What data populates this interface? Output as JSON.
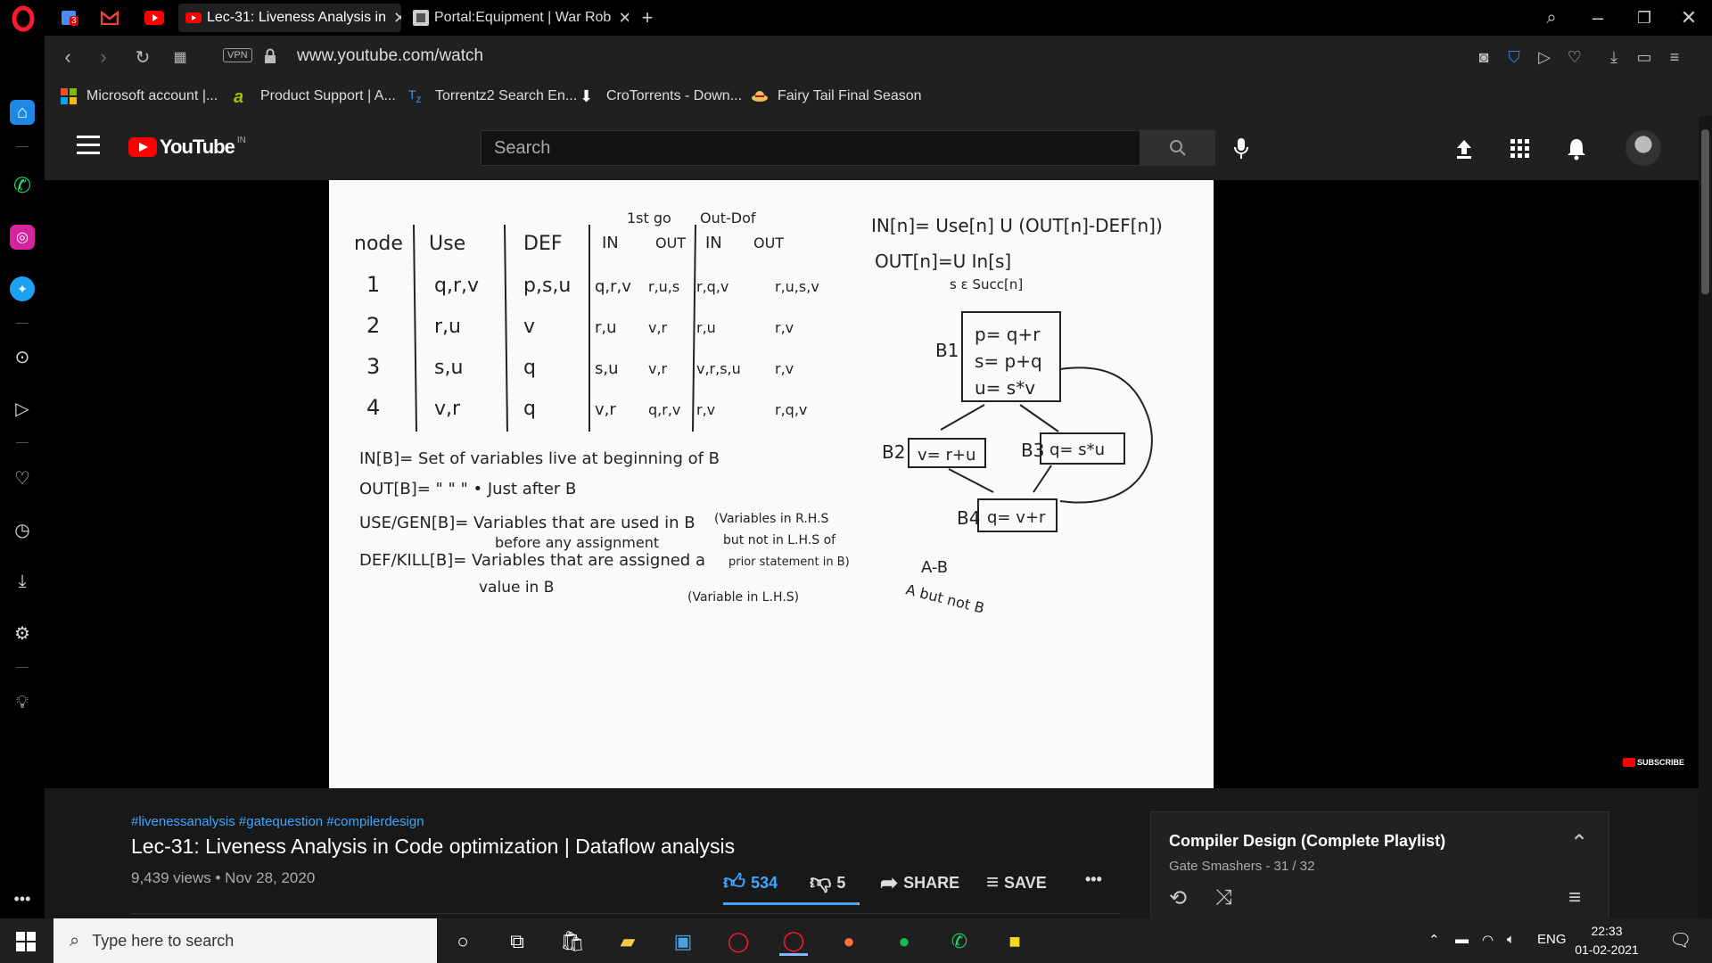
{
  "browser": {
    "tabs": [
      {
        "title": "Lec-31: Liveness Analysis in",
        "favicon": "youtube-icon",
        "active": true
      },
      {
        "title": "Portal:Equipment | War Rob",
        "favicon": "wiki-icon",
        "active": false
      }
    ],
    "pinned_badge": "3",
    "address": {
      "vpn_label": "VPN",
      "url": "www.youtube.com/watch"
    },
    "bookmarks": [
      {
        "label": "Microsoft account |...",
        "icon": "microsoft-icon"
      },
      {
        "label": "Product Support | A...",
        "icon": "product-support-icon"
      },
      {
        "label": "Torrentz2 Search En...",
        "icon": "torrentz-icon"
      },
      {
        "label": "CroTorrents - Down...",
        "icon": "download-arrow-icon"
      },
      {
        "label": "Fairy Tail Final Season",
        "icon": "straw-hat-icon"
      }
    ]
  },
  "youtube": {
    "logo_text": "YouTube",
    "country_code": "IN",
    "search_placeholder": "Search",
    "subscribe_watermark": "SUBSCRIBE",
    "video": {
      "hashtags": "#livenessanalysis #gatequestion #compilerdesign",
      "title": "Lec-31: Liveness Analysis in Code optimization | Dataflow analysis",
      "meta": "9,439 views • Nov 28, 2020",
      "likes": "534",
      "dislikes": "5",
      "share_label": "SHARE",
      "save_label": "SAVE",
      "like_ratio": 0.99
    },
    "playlist": {
      "title": "Compiler Design (Complete Playlist)",
      "subtitle": "Gate Smashers - 31 / 32"
    }
  },
  "whiteboard": {
    "table_headers": [
      "node",
      "Use",
      "DEF",
      "1st go",
      "IN",
      "OUT",
      "Out-Dof",
      "IN",
      "OUT"
    ],
    "rows": [
      {
        "node": "1",
        "use": "q,r,v",
        "def": "p,s,u",
        "in1": "q,r,v",
        "out1": "r,u,s",
        "in2": "r,q,v",
        "out2": "r,u,s,v"
      },
      {
        "node": "2",
        "use": "r,u",
        "def": "v",
        "in1": "r,u",
        "out1": "v,r",
        "in2": "r,u",
        "out2": "r,v"
      },
      {
        "node": "3",
        "use": "s,u",
        "def": "q",
        "in1": "s,u",
        "out1": "v,r",
        "in2": "v,r,s,u",
        "out2": "r,v"
      },
      {
        "node": "4",
        "use": "v,r",
        "def": "q",
        "in1": "v,r",
        "out1": "q,r,v",
        "in2": "r,v",
        "out2": "r,q,v"
      }
    ],
    "equations": [
      "IN[n]= Use[n] U (OUT[n]-DEF[n])",
      "OUT[n]=U In[s]",
      "s ε Succ[n]"
    ],
    "blocks": {
      "b1_label": "B1",
      "b1_lines": [
        "p= q+r",
        "s= p+q",
        "u= s*v"
      ],
      "b2_label": "B2",
      "b2": "v= r+u",
      "b3_label": "B3",
      "b3": "q= s*u",
      "b4_label": "B4",
      "b4": "q= v+r"
    },
    "notes": [
      "IN[B]= Set of variables live at beginning of B",
      "OUT[B]= \"   \"   \" • Just after B",
      "USE/GEN[B]= Variables that are used in B",
      "before any assignment",
      "(Variables in R.H.S",
      "but not in L.H.S of",
      "prior statement in B)",
      "DEF/KILL[B]= Variables that are assigned a",
      "value in B",
      "(Variable in L.H.S)",
      "A-B",
      "A but not B"
    ]
  },
  "taskbar": {
    "search_placeholder": "Type here to search",
    "language": "ENG",
    "time": "22:33",
    "date": "01-02-2021"
  }
}
